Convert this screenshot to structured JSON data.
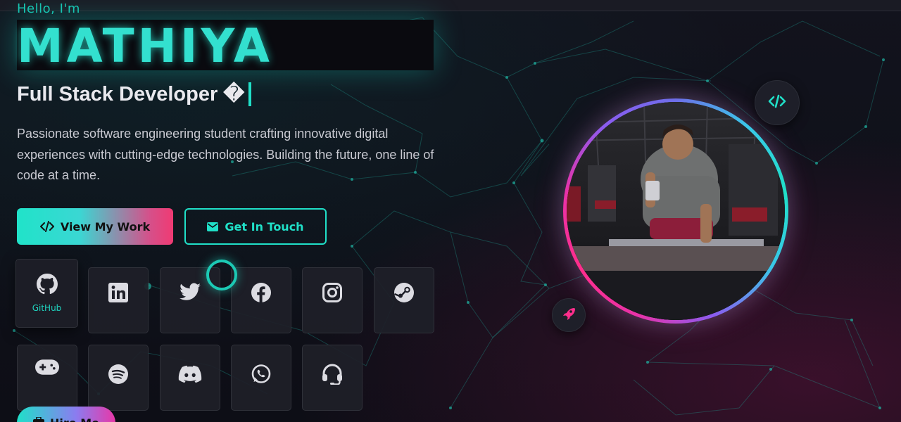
{
  "hero": {
    "greeting": "Hello, I'm",
    "name": "MATHIYA",
    "role": "Full Stack Developer �",
    "bio": "Passionate software engineering student crafting innovative digital experiences with cutting-edge technologies. Building the future, one line of code at a time."
  },
  "buttons": {
    "view_work": "View My Work",
    "get_in_touch": "Get In Touch",
    "hire_me": "Hire Me"
  },
  "socials": [
    {
      "icon": "github-icon",
      "label": "GitHub"
    },
    {
      "icon": "linkedin-icon"
    },
    {
      "icon": "twitter-icon"
    },
    {
      "icon": "facebook-icon"
    },
    {
      "icon": "instagram-icon"
    },
    {
      "icon": "steam-icon"
    },
    {
      "icon": "gamepad-icon"
    },
    {
      "icon": "spotify-icon"
    },
    {
      "icon": "discord-icon"
    },
    {
      "icon": "whatsapp-icon"
    },
    {
      "icon": "headset-icon"
    }
  ],
  "badges": {
    "code": "code-icon",
    "rocket": "rocket-icon"
  },
  "colors": {
    "accent_teal": "#20e0c8",
    "accent_pink": "#e832a8",
    "background": "#0e0f18"
  }
}
